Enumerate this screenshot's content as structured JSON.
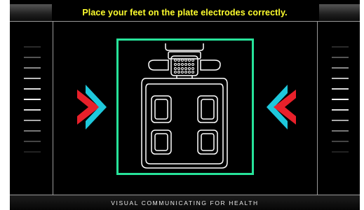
{
  "header": {
    "instruction": "Place your feet on the plate electrodes correctly."
  },
  "footer": {
    "text": "VISUAL COMMUNICATING FOR HEALTH"
  },
  "indicators": {
    "left_icon": "arrow-right-icon",
    "right_icon": "arrow-left-icon",
    "arrow_colors": {
      "outer": "#1ec8dc",
      "inner": "#e8202a"
    }
  },
  "colors": {
    "title": "#ffff2e",
    "frame": "#27e39a",
    "background": "#000000"
  },
  "device": {
    "icon": "body-composition-scale-icon"
  }
}
